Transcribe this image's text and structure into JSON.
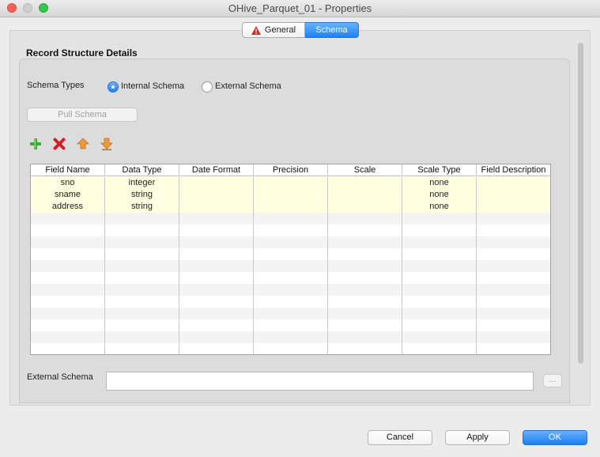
{
  "window": {
    "title": "OHive_Parquet_01 - Properties"
  },
  "tabs": [
    {
      "label": "General",
      "icon": "warning-icon",
      "selected": false
    },
    {
      "label": "Schema",
      "selected": true
    }
  ],
  "section": {
    "title": "Record Structure Details"
  },
  "schema_types": {
    "label": "Schema Types",
    "options": [
      {
        "label": "Internal Schema",
        "selected": true
      },
      {
        "label": "External Schema",
        "selected": false
      }
    ]
  },
  "pull_schema": {
    "label": "Pull Schema",
    "enabled": false
  },
  "toolbar": {
    "icons": [
      "add-icon",
      "delete-icon",
      "move-up-icon",
      "move-down-icon"
    ]
  },
  "table": {
    "columns": [
      "Field Name",
      "Data Type",
      "Date Format",
      "Precision",
      "Scale",
      "Scale Type",
      "Field Description"
    ],
    "rows": [
      [
        "sno",
        "integer",
        "",
        "",
        "",
        "none",
        ""
      ],
      [
        "sname",
        "string",
        "",
        "",
        "",
        "none",
        ""
      ],
      [
        "address",
        "string",
        "",
        "",
        "",
        "none",
        ""
      ]
    ]
  },
  "external_schema": {
    "label": "External Schema",
    "value": "",
    "browse_label": "..."
  },
  "buttons": {
    "cancel": "Cancel",
    "apply": "Apply",
    "ok": "OK"
  },
  "colors": {
    "accent": "#1a82fb",
    "filled_row": "#fefee1"
  }
}
